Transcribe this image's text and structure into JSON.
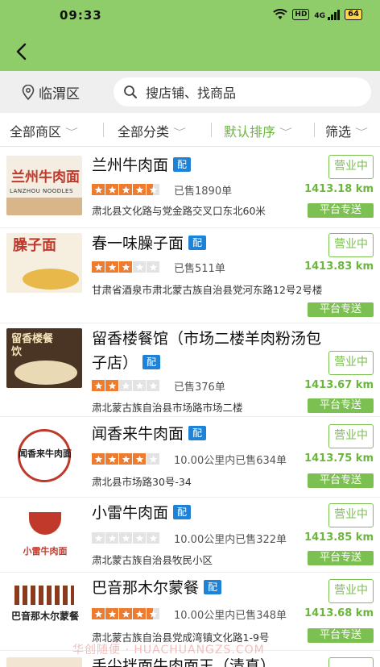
{
  "status_bar": {
    "time": "09:33",
    "network": "4G",
    "hd": "HD",
    "battery": "64"
  },
  "search": {
    "location": "临渭区",
    "placeholder": "搜店铺、找商品"
  },
  "filters": [
    {
      "label": "全部商区"
    },
    {
      "label": "全部分类"
    },
    {
      "label": "默认排序"
    },
    {
      "label": "筛选"
    }
  ],
  "delivery_badge": "配",
  "open_label": "营业中",
  "platform_label": "平台专送",
  "shops": [
    {
      "name": "兰州牛肉面",
      "rating": 4.5,
      "sold": "已售1890单",
      "distance": "1413.18 km",
      "address": "肃北县文化路与党金路交叉口东北60米",
      "thumb_text": "兰州牛肉面",
      "thumb_sub": "LANZHOU NOODLES"
    },
    {
      "name": "春一味臊子面",
      "rating": 3,
      "sold": "已售511单",
      "distance": "1413.83 km",
      "address": "甘肃省酒泉市肃北蒙古族自治县党河东路12号2号楼",
      "thumb_text": "臊子面"
    },
    {
      "name_line1": "留香楼餐馆（市场二楼羊肉粉汤包",
      "name_line2": "子店）",
      "rating": 2,
      "sold": "已售376单",
      "distance": "1413.67 km",
      "address": "肃北蒙古族自治县市场路市场二楼",
      "thumb_text": "留香楼餐饮"
    },
    {
      "name": "闻香来牛肉面",
      "rating": 4,
      "sold": "10.00公里内已售634单",
      "distance": "1413.75 km",
      "address": "肃北县市场路30号-34",
      "thumb_text": "闻香来牛肉面"
    },
    {
      "name": "小雷牛肉面",
      "rating": 0,
      "sold": "10.00公里内已售322单",
      "distance": "1413.85 km",
      "address": "肃北蒙古族自治县牧民小区",
      "thumb_text": "小雷牛肉面"
    },
    {
      "name": "巴音那木尔蒙餐",
      "rating": 4.5,
      "sold": "10.00公里内已售348单",
      "distance": "1413.68 km",
      "address": "肃北蒙古族自治县党成湾镇文化路1-9号",
      "thumb_text": "巴音那木尔蒙餐"
    },
    {
      "name": "手尖拌面牛肉面王（清真）"
    }
  ],
  "watermark": "华创随便 · HUACHUANGZS.COM",
  "colors": {
    "header_green": "#8fcd6a",
    "accent_green": "#6cb53e",
    "star_orange": "#ef7b2e",
    "badge_blue": "#1e82d6"
  }
}
